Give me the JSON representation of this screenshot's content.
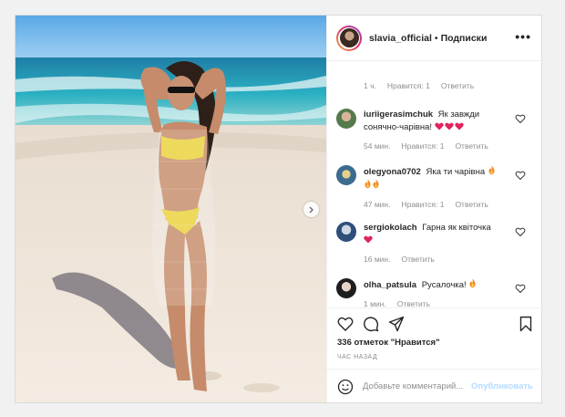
{
  "header": {
    "username": "slavia_official",
    "separator": "•",
    "follow_label": "Подписки",
    "more_label": "•••"
  },
  "top_meta": {
    "time": "1 ч.",
    "likes": "Нравится: 1",
    "reply": "Ответить"
  },
  "comments": [
    {
      "username": "iuriigerasimchuk",
      "text": "Як завжди сонячно-чарівна!",
      "emoji": "heart-emoji x3",
      "time": "54 мин.",
      "likes": "Нравится: 1",
      "reply": "Ответить"
    },
    {
      "username": "olegyona0702",
      "text": "Яка ти чарівна",
      "emoji": "fire-emoji x3",
      "time": "47 мин.",
      "likes": "Нравится: 1",
      "reply": "Ответить"
    },
    {
      "username": "sergiokolach",
      "text": "Гарна як квіточка",
      "emoji": "heart-emoji x1",
      "time": "16 мин.",
      "reply": "Ответить"
    },
    {
      "username": "olha_patsula",
      "text": "Русалочка!",
      "emoji": "fire-emoji x1",
      "time": "1 мин.",
      "reply": "Ответить"
    }
  ],
  "post": {
    "likes_text": "336 отметок \"Нравится\"",
    "posted_time": "ЧАС НАЗАД"
  },
  "add_comment": {
    "placeholder": "Добавьте комментарий...",
    "post_label": "Опубликовать"
  },
  "colors": {
    "accent_link": "#b3dbff",
    "heart_red": "#ed4956",
    "meta_gray": "#8e8e8e"
  }
}
